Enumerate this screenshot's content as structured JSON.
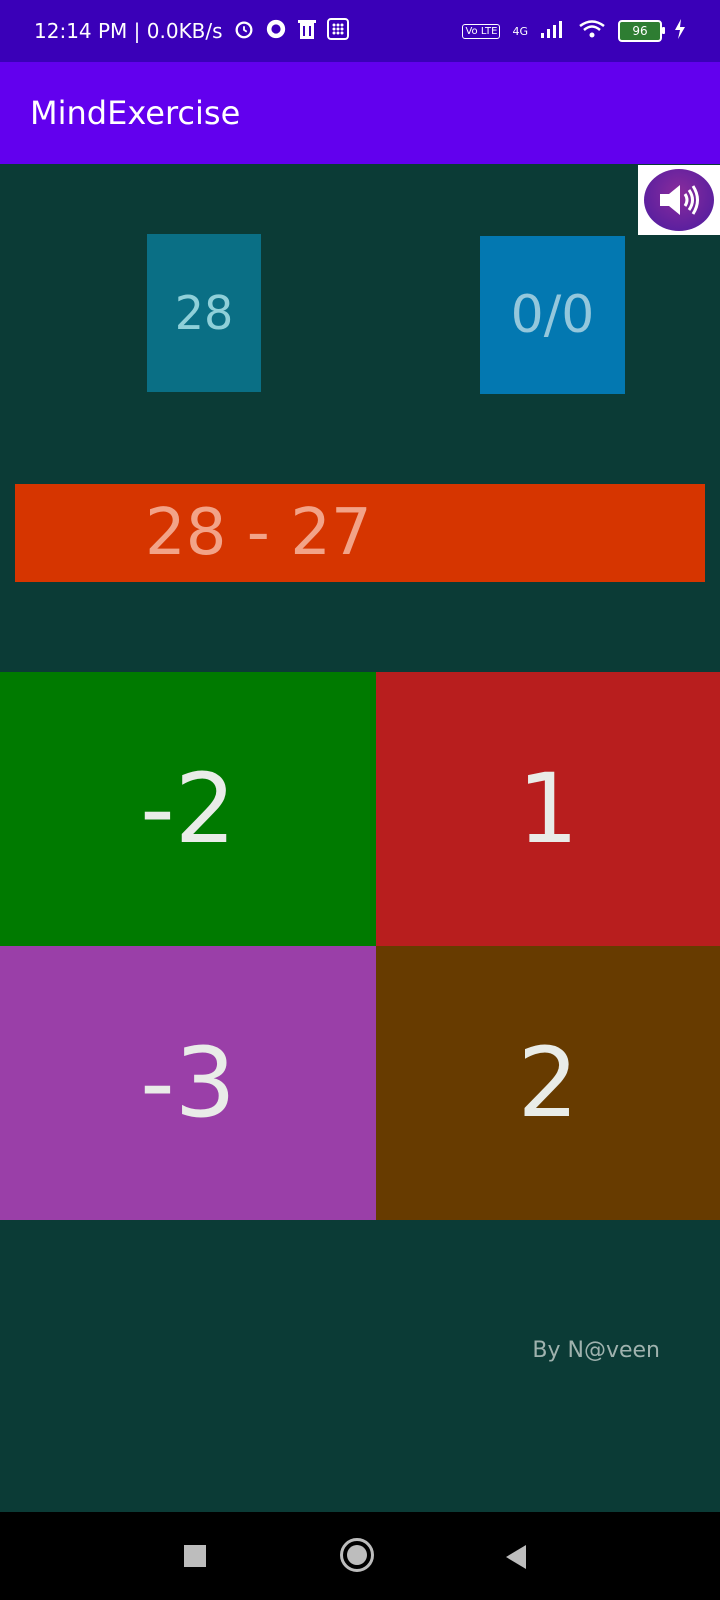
{
  "status_bar": {
    "time_speed": "12:14 PM | 0.0KB/s",
    "icons": [
      "alarm-icon",
      "app-icon",
      "trash-icon",
      "grid-icon"
    ],
    "network_label": "4G",
    "volte": "Vo LTE",
    "battery": "96"
  },
  "app": {
    "title": "MindExercise"
  },
  "game": {
    "timer": "28",
    "score": "0/0",
    "question": "28 - 27",
    "answers": [
      "-2",
      "1",
      "-3",
      "2"
    ],
    "credit": "By N@veen"
  },
  "colors": {
    "status_bar": "#3a00b8",
    "app_bar": "#6200ee",
    "background": "#0b3b36",
    "question_bar": "#d63500",
    "answer_1": "#007a00",
    "answer_2": "#b81e1e",
    "answer_3": "#9a3fa8",
    "answer_4": "#673b00"
  }
}
